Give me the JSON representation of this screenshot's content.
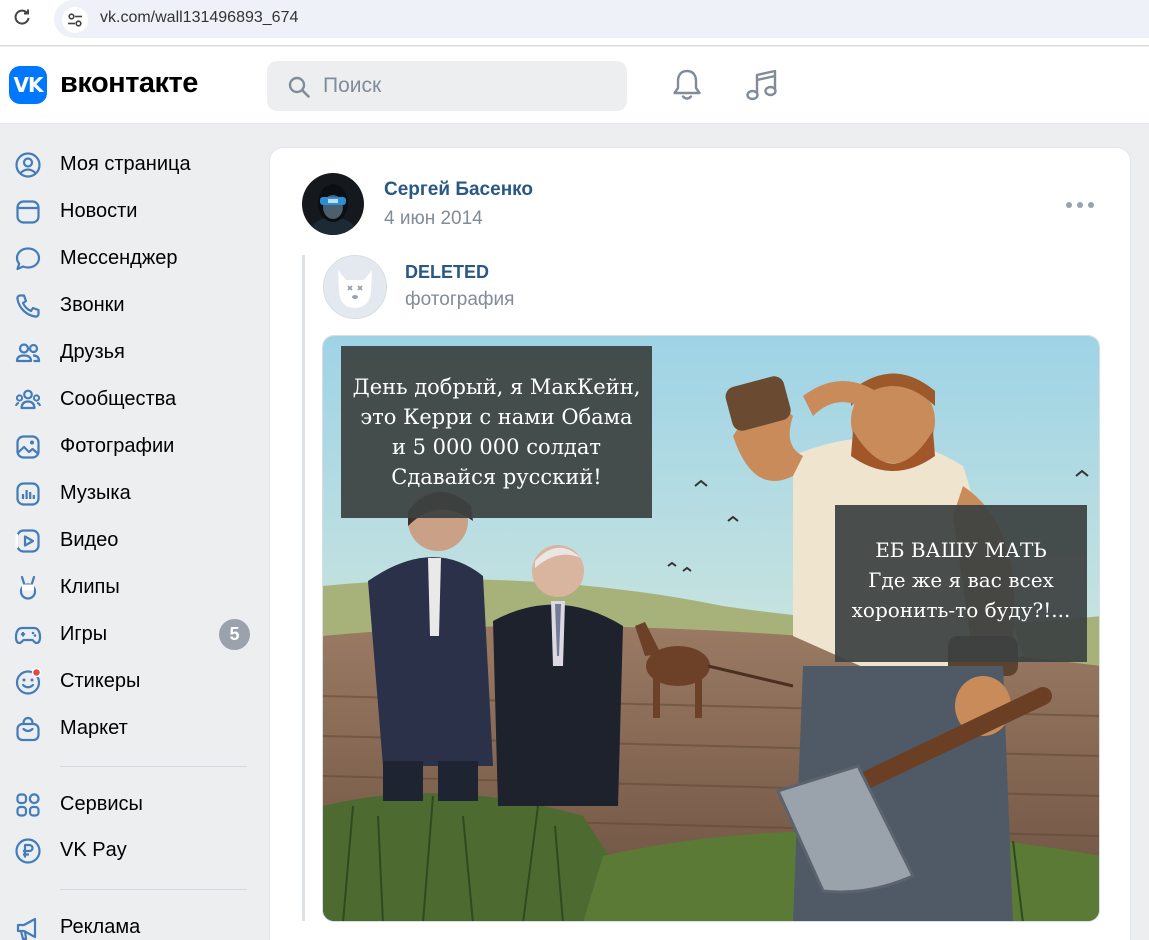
{
  "browser": {
    "url": "vk.com/wall131496893_674",
    "reload_icon": "reload-icon",
    "site_info_icon": "tune-icon"
  },
  "header": {
    "logo_mark": "VK",
    "logo_text": "вконтакте",
    "search_placeholder": "Поиск",
    "notifications_icon": "bell-icon",
    "music_icon": "music-note-icon",
    "brand_color": "#0077ff"
  },
  "sidebar": {
    "items": [
      {
        "label": "Моя страница",
        "icon": "user-circle-icon"
      },
      {
        "label": "Новости",
        "icon": "newspaper-icon"
      },
      {
        "label": "Мессенджер",
        "icon": "message-bubble-icon"
      },
      {
        "label": "Звонки",
        "icon": "phone-icon"
      },
      {
        "label": "Друзья",
        "icon": "users-icon"
      },
      {
        "label": "Сообщества",
        "icon": "community-icon"
      },
      {
        "label": "Фотографии",
        "icon": "picture-icon"
      },
      {
        "label": "Музыка",
        "icon": "music-bars-icon"
      },
      {
        "label": "Видео",
        "icon": "video-play-icon"
      },
      {
        "label": "Клипы",
        "icon": "clips-icon"
      },
      {
        "label": "Игры",
        "icon": "gamepad-icon",
        "counter": "5"
      },
      {
        "label": "Стикеры",
        "icon": "smile-icon"
      },
      {
        "label": "Маркет",
        "icon": "shopping-bag-icon"
      },
      {
        "label": "Сервисы",
        "icon": "grid-icon"
      },
      {
        "label": "VK Pay",
        "icon": "ruble-icon"
      },
      {
        "label": "Реклама",
        "icon": "megaphone-icon"
      }
    ]
  },
  "post": {
    "author": "Сергей Басенко",
    "date": "4 июн 2014",
    "more_icon": "more-horizontal-icon",
    "repost": {
      "author": "DELETED",
      "subtitle": "фотография",
      "avatar_icon": "deleted-dog-icon"
    },
    "image": {
      "caption_top": [
        "День добрый, я МакКейн,",
        "это Керри с нами Обама",
        "и 5 000 000 солдат",
        "Сдавайся русский!"
      ],
      "caption_right": [
        "ЕБ ВАШУ МАТЬ",
        "Где же я вас всех",
        "хоронить-то буду?!..."
      ]
    }
  }
}
